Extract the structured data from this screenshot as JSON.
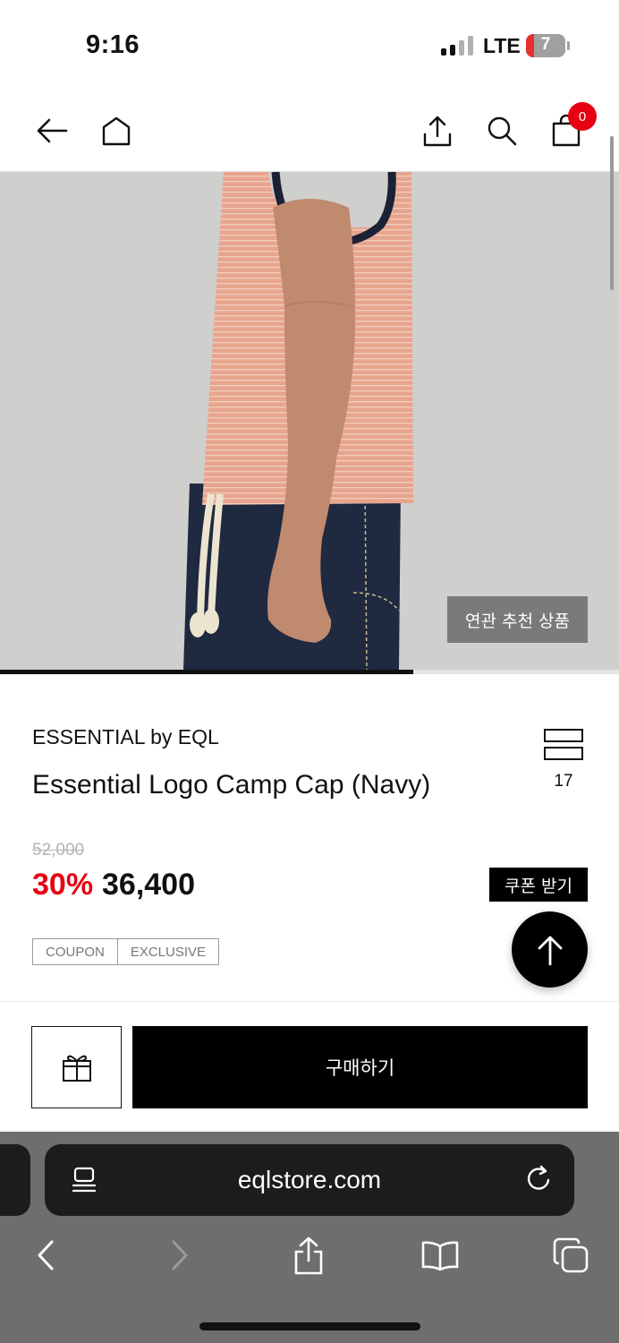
{
  "status_bar": {
    "time": "9:16",
    "network": "LTE",
    "battery_level": "7",
    "icons": [
      "signal-icon",
      "battery-icon"
    ]
  },
  "header": {
    "icons": [
      "back-arrow-icon",
      "home-icon",
      "share-icon",
      "search-icon",
      "shopping-bag-icon"
    ],
    "cart_count": "0"
  },
  "hero": {
    "related_button_label": "연관 추천 상품",
    "carousel_progress": 0.667
  },
  "product": {
    "brand": "ESSENTIAL by EQL",
    "name": "Essential Logo Camp Cap (Navy)",
    "list_count": "17",
    "original_price": "52,000",
    "discount_rate": "30%",
    "sale_price": "36,400",
    "coupon_button_label": "쿠폰 받기",
    "tags": [
      "COUPON",
      "EXCLUSIVE"
    ]
  },
  "actions": {
    "gift_icon": "gift-icon",
    "buy_label": "구매하기",
    "scroll_top_icon": "arrow-up-icon"
  },
  "browser": {
    "url": "eqlstore.com",
    "icons": [
      "reader-icon",
      "reload-icon",
      "chevron-left-icon",
      "chevron-right-icon",
      "share-icon",
      "bookmarks-icon",
      "tabs-icon"
    ]
  },
  "colors": {
    "accent_red": "#e60012",
    "primary_black": "#000000",
    "browser_bar": "#6e6e6e"
  }
}
